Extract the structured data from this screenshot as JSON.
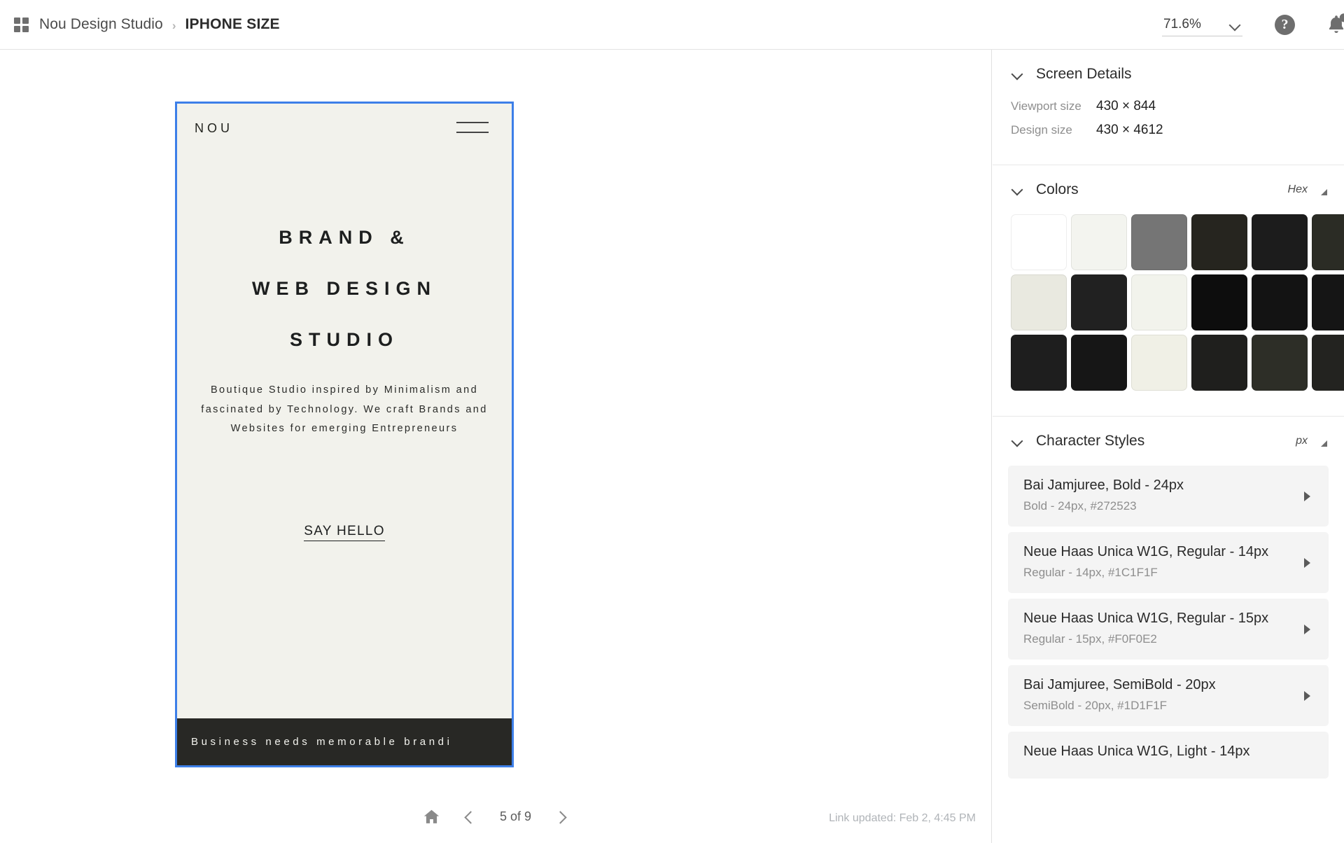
{
  "topbar": {
    "grid_icon": "apps-grid-icon",
    "project_name": "Nou Design Studio",
    "separator": "›",
    "current_screen": "IPHONE SIZE",
    "zoom_level": "71.6%",
    "help_icon": "question-mark-icon",
    "bell_icon": "notification-bell-icon"
  },
  "artboard": {
    "logo": "NOU",
    "menu_icon": "hamburger-menu-icon",
    "headline_lines": [
      "BRAND &",
      "WEB DESIGN",
      "STUDIO"
    ],
    "body_copy": "Boutique Studio inspired by Minimalism and fascinated by Technology. We craft Brands and Websites for emerging Entrepreneurs",
    "cta_label": "SAY HELLO",
    "ticker_text": "Business needs memorable brandi",
    "background_color": "#F2F2EC",
    "ticker_background": "#282825",
    "selection_color": "#3D7FE8"
  },
  "bottom_nav": {
    "home_icon": "home-icon",
    "prev_icon": "chevron-left-icon",
    "next_icon": "chevron-right-icon",
    "page_indicator": "5 of 9",
    "link_updated": "Link updated: Feb 2, 4:45 PM"
  },
  "panel": {
    "screen_details": {
      "title": "Screen Details",
      "rows": [
        {
          "label": "Viewport size",
          "value": "430 × 844"
        },
        {
          "label": "Design size",
          "value": "430 × 4612"
        }
      ]
    },
    "colors": {
      "title": "Colors",
      "unit": "Hex",
      "swatches": [
        "#FFFFFF",
        "#F3F4EF",
        "#757575",
        "#26251F",
        "#1C1C1C",
        "#2B2C25",
        "#E9E9E0",
        "#212121",
        "#F2F3EC",
        "#0D0D0D",
        "#131313",
        "#151515",
        "#1E1E1E",
        "#161616",
        "#F0F0E6",
        "#1F1F1D",
        "#2D2E27",
        "#232320"
      ]
    },
    "character_styles": {
      "title": "Character Styles",
      "unit": "px",
      "items": [
        {
          "name": "Bai Jamjuree, Bold - 24px",
          "meta": "Bold - 24px, #272523"
        },
        {
          "name": "Neue Haas Unica W1G, Regular - 14px",
          "meta": "Regular - 14px, #1C1F1F"
        },
        {
          "name": "Neue Haas Unica W1G, Regular - 15px",
          "meta": "Regular - 15px, #F0F0E2"
        },
        {
          "name": "Bai Jamjuree, SemiBold - 20px",
          "meta": "SemiBold - 20px, #1D1F1F"
        },
        {
          "name": "Neue Haas Unica W1G, Light - 14px",
          "meta": ""
        }
      ]
    }
  }
}
